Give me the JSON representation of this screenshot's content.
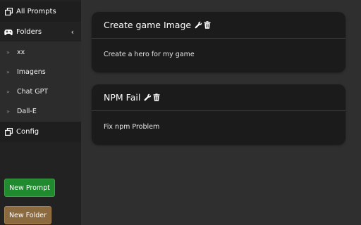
{
  "sidebar": {
    "all_prompts": "All Prompts",
    "folders": "Folders",
    "folder_items": [
      "xx",
      "Imagens",
      "Chat GPT",
      "Dall-E"
    ],
    "config": "Config",
    "new_prompt": "New Prompt",
    "new_folder": "New Folder",
    "icons": {
      "all_prompts": "copy-icon",
      "folders": "gamepad-icon",
      "folders_toggle": "chevron-left-icon",
      "folder_bullet": "double-chevron-right-icon",
      "config": "copy-icon"
    }
  },
  "prompts": [
    {
      "title": "Create game Image",
      "body": "Create a hero for my game",
      "icons": [
        "wrench-icon",
        "trash-icon"
      ]
    },
    {
      "title": "NPM Fail",
      "body": "Fix npm Problem",
      "icons": [
        "wrench-icon",
        "trash-icon"
      ]
    }
  ],
  "colors": {
    "background": "#2f2f2f",
    "sidebar": "#222222",
    "card": "#1b1b1b",
    "new_prompt_button": "#1f8a2e",
    "new_folder_button": "#8c6a3f"
  }
}
